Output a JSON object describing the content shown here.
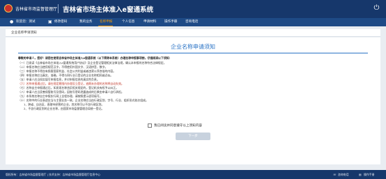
{
  "header": {
    "org_name": "吉林省市场监督管理厅",
    "system_title": "吉林省市场主体准入e窗通系统"
  },
  "nav": {
    "welcome": "欢迎您：测试",
    "items": [
      "修改密码",
      "我的业务",
      "名称申报",
      "个人信息",
      "申请材料",
      "操作手册",
      "咨询电话"
    ],
    "active_index": 1
  },
  "breadcrumb": "企业名称申请须知",
  "panel": {
    "title": "企业名称申请须知",
    "lines": [
      "尊敬的申请人，您好！请您在使用吉林省市场主体准入e窗通系统（以下简称本系统）办理名称申报事项前，仔细阅读以下须知：",
      "（一）已阅读《吉林省市场主体准入e窗通系统用户协议》及企业登记管理相关法律法规，确认本申报的名称符合法律规定。",
      "（二）申报名称应当使用规范汉字，不得使用外国文字、汉语拼音、数字。",
      "（三）申报名称不得含有损害国家利益、社会公共利益或者违背公序良俗的内容。",
      "（四）申报名称应当真实、准确，不得与同行业已登记的企业名称相同或近似。",
      "（五）申请人应当如实填写申报信息，并对申报信息的真实性负责。",
      "（六）名称申报通过后，请在规定期限内办理设立登记，逾期未办理的名称将自动失效。",
      "（七）名称自主申报通过后，如发现名称违反相关规定的，登记机关有权予以纠正。",
      "（八）申请人应当妥善保管账号及密码，因账号密码泄露造成的后果由申请人自行承担。",
      "（九）本系统名称自主申报实行网上全程办理，请按照提示逐项填写。",
      "（十）名称中的行业表述应当与主营业务一致，企业名称应当由行政区划、字号、行业、组织形式依次组成。",
      "1、跨省、自治区、直辖市经营的企业，其名称可以不含行政区划。",
      "2、不含行政区划的企业名称，由国家市场监督管理总局统一登记。"
    ]
  },
  "agree_label": "我已阅读并同意遵守以上须知内容",
  "next_button": "下一步",
  "footer": {
    "copyright": "版权所有：吉林省市场监督管理厅 | 技术支持：吉林省市场监督管理厅信息中心",
    "hotline": "咨询电话",
    "manual": "操作手册"
  }
}
